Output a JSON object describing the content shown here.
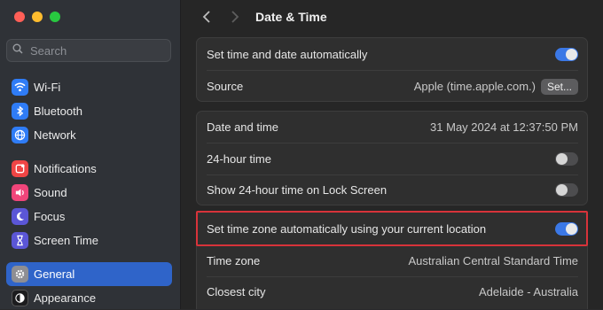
{
  "window": {
    "traffic_lights": {
      "close": "#ff5f57",
      "minimize": "#febc2e",
      "zoom": "#28c840"
    }
  },
  "sidebar": {
    "search_placeholder": "Search",
    "items": [
      {
        "label": "Wi-Fi",
        "icon": "wifi-icon",
        "color": "#2f7cf6"
      },
      {
        "label": "Bluetooth",
        "icon": "bluetooth-icon",
        "color": "#2f7cf6"
      },
      {
        "label": "Network",
        "icon": "globe-icon",
        "color": "#2f7cf6"
      },
      {
        "label": "Notifications",
        "icon": "bell-icon",
        "color": "#f04545"
      },
      {
        "label": "Sound",
        "icon": "speaker-icon",
        "color": "#f0457a"
      },
      {
        "label": "Focus",
        "icon": "moon-icon",
        "color": "#5b56d6"
      },
      {
        "label": "Screen Time",
        "icon": "hourglass-icon",
        "color": "#5b56d6"
      },
      {
        "label": "General",
        "icon": "gear-icon",
        "color": "#8e8e93",
        "selected": true
      },
      {
        "label": "Appearance",
        "icon": "appearance-icon",
        "color": "#1c1c1e"
      }
    ]
  },
  "header": {
    "title": "Date & Time"
  },
  "groups": {
    "auto": {
      "set_auto_label": "Set time and date automatically",
      "set_auto_on": true,
      "source_label": "Source",
      "source_value": "Apple (time.apple.com.)",
      "source_button": "Set..."
    },
    "datetime": {
      "date_time_label": "Date and time",
      "date_time_value": "31 May 2024 at 12:37:50 PM",
      "hour24_label": "24-hour time",
      "hour24_on": false,
      "lock_label": "Show 24-hour time on Lock Screen",
      "lock_on": false
    },
    "timezone": {
      "auto_tz_label": "Set time zone automatically using your current location",
      "auto_tz_on": true,
      "tz_label": "Time zone",
      "tz_value": "Australian Central Standard Time",
      "city_label": "Closest city",
      "city_value": "Adelaide - Australia"
    }
  },
  "colors": {
    "accent": "#3b78e6",
    "highlight_box": "#d8333a"
  }
}
